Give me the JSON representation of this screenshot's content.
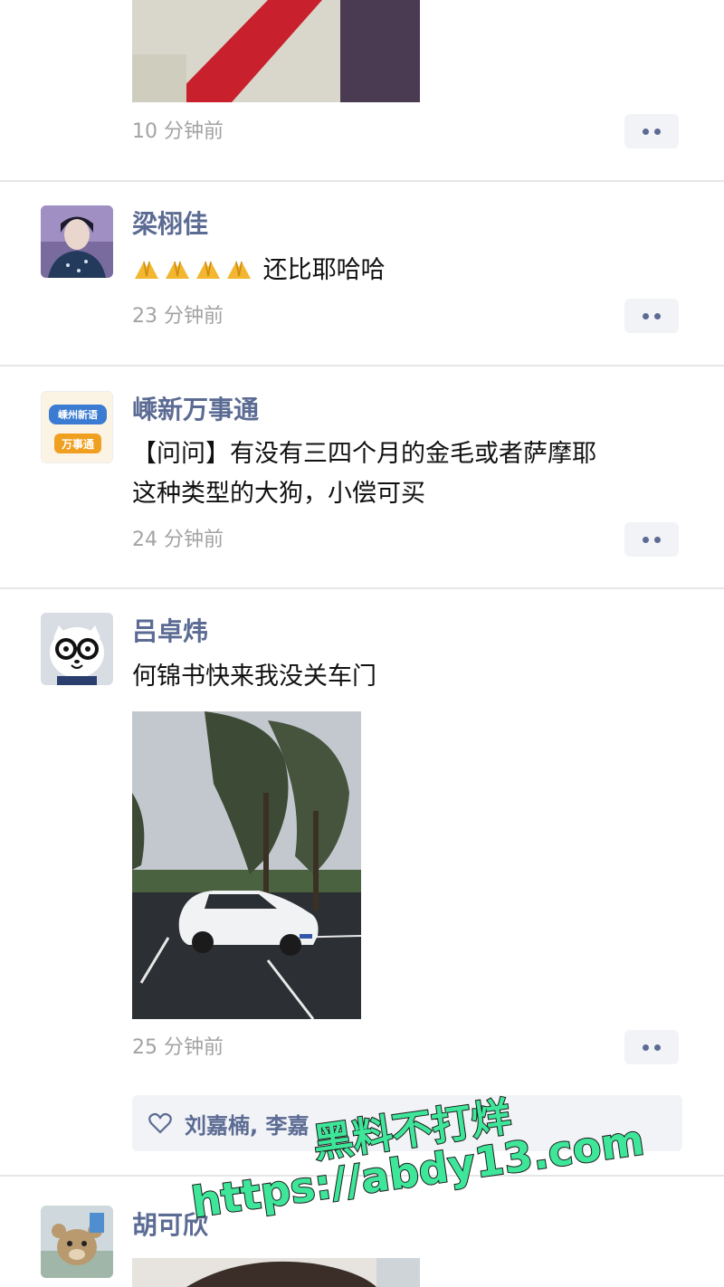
{
  "posts": [
    {
      "time": "10 分钟前"
    },
    {
      "name": "梁栩佳",
      "text_suffix": "还比耶哈哈",
      "emoji": "praying-hands",
      "emoji_count": 4,
      "time": "23 分钟前"
    },
    {
      "name": "嵊新万事通",
      "text_line1": "【问问】有没有三四个月的金毛或者萨摩耶",
      "text_line2": "这种类型的大狗，小偿可买",
      "time": "24 分钟前",
      "avatar_logo_top": "嵊州新语",
      "avatar_logo_bottom": "万事通"
    },
    {
      "name": "吕卓炜",
      "text": "何锦书快来我没关车门",
      "time": "25 分钟前",
      "likes": "刘嘉楠, 李嘉"
    },
    {
      "name": "胡可欣"
    }
  ],
  "watermark": {
    "line1": "黑料不打烊",
    "line2": "https://abdy13.com"
  },
  "colors": {
    "name": "#5b6b93",
    "time": "#a3a3a3",
    "divider": "#e6e6e6",
    "button_bg": "#f2f3f6",
    "watermark": "#3ee69a"
  }
}
